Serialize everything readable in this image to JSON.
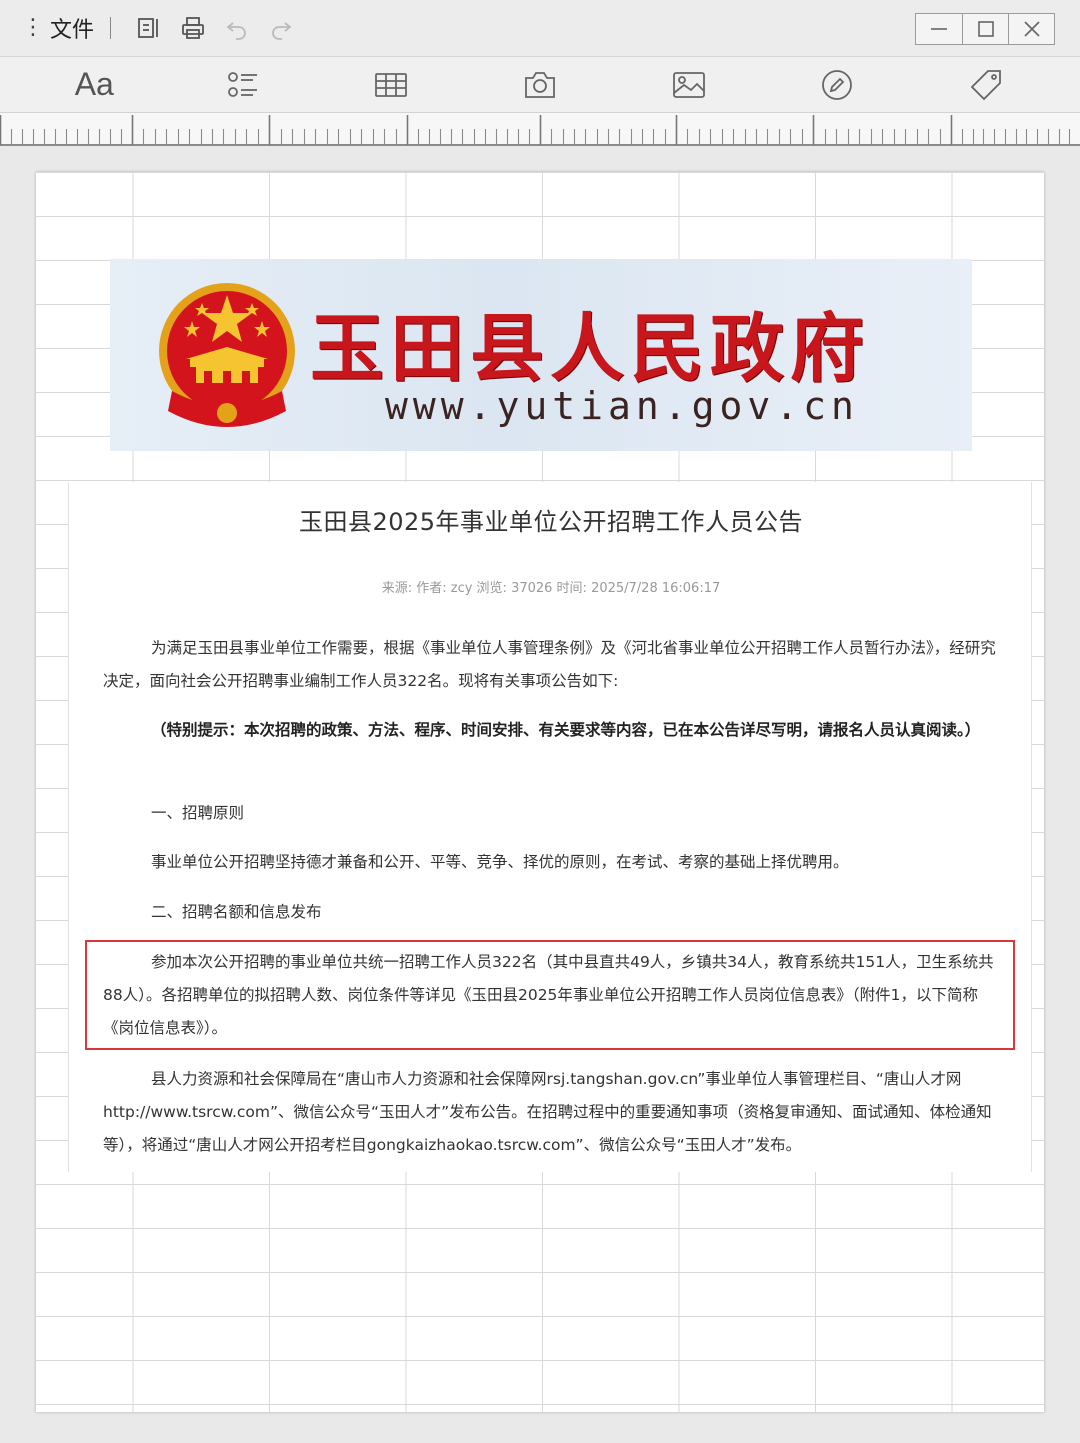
{
  "titlebar": {
    "menu_label": "文件"
  },
  "toolbar": {
    "font_label": "Aa"
  },
  "banner": {
    "title": "玉田县人民政府",
    "url": "www.yutian.gov.cn"
  },
  "article": {
    "title": "玉田县2025年事业单位公开招聘工作人员公告",
    "meta": "来源:  作者:  zcy 浏览:  37026 时间:  2025/7/28 16:06:17",
    "p1": "为满足玉田县事业单位工作需要，根据《事业单位人事管理条例》及《河北省事业单位公开招聘工作人员暂行办法》，经研究决定，面向社会公开招聘事业编制工作人员322名。现将有关事项公告如下:",
    "p2": "（特别提示：本次招聘的政策、方法、程序、时间安排、有关要求等内容，已在本公告详尽写明，请报名人员认真阅读。）",
    "h1": "一、招聘原则",
    "p3": "事业单位公开招聘坚持德才兼备和公开、平等、竞争、择优的原则，在考试、考察的基础上择优聘用。",
    "h2": "二、招聘名额和信息发布",
    "p4": "参加本次公开招聘的事业单位共统一招聘工作人员322名（其中县直共49人，乡镇共34人，教育系统共151人，卫生系统共88人）。各招聘单位的拟招聘人数、岗位条件等详见《玉田县2025年事业单位公开招聘工作人员岗位信息表》（附件1，以下简称《岗位信息表》）。",
    "p5": "县人力资源和社会保障局在“唐山市人力资源和社会保障网rsj.tangshan.gov.cn”事业单位人事管理栏目、“唐山人才网http://www.tsrcw.com”、微信公众号“玉田人才”发布公告。在招聘过程中的重要通知事项（资格复审通知、面试通知、体检通知等），将通过“唐山人才网公开招考栏目gongkaizhaokao.tsrcw.com”、微信公众号“玉田人才”发布。"
  },
  "colors": {
    "banner_red": "#c8161d",
    "highlight_border": "#d83838"
  },
  "icons": [
    "menu-dots-icon",
    "page-layout-icon",
    "print-icon",
    "undo-icon",
    "redo-icon",
    "minimize-icon",
    "maximize-icon",
    "close-icon",
    "list-icon",
    "table-icon",
    "camera-icon",
    "image-icon",
    "pen-icon",
    "tag-icon",
    "national-emblem-icon"
  ]
}
